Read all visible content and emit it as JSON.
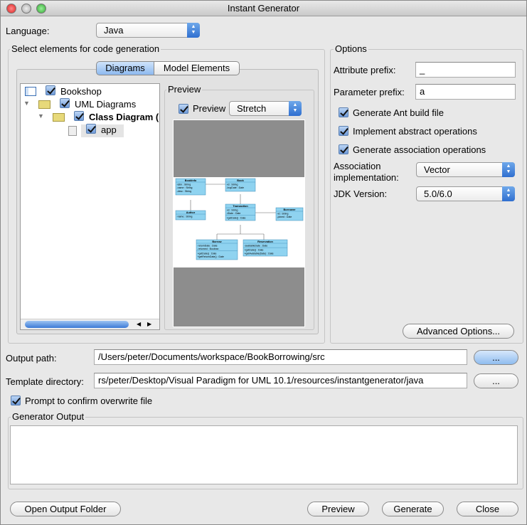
{
  "window": {
    "title": "Instant Generator"
  },
  "language": {
    "label": "Language:",
    "value": "Java"
  },
  "select_group": {
    "title": "Select elements for code generation",
    "tabs": [
      {
        "label": "Diagrams",
        "active": true
      },
      {
        "label": "Model Elements",
        "active": false
      }
    ]
  },
  "tree": [
    {
      "label": "Bookshop",
      "checked": true
    },
    {
      "label": "UML Diagrams",
      "checked": true
    },
    {
      "label": "Class Diagram (",
      "checked": true
    },
    {
      "label": "app",
      "checked": true
    }
  ],
  "preview": {
    "group_title": "Preview",
    "checkbox_label": "Preview",
    "checked": true,
    "mode": "Stretch",
    "diagram": {
      "classes": [
        {
          "name": "BookInfo",
          "attrs": [
            "-isbn : String",
            "-name : String",
            "-desc : String"
          ],
          "ops": []
        },
        {
          "name": "Book",
          "attrs": [
            "-id : String",
            "-buyDate : Date"
          ],
          "ops": []
        },
        {
          "name": "Author",
          "attrs": [
            "-name : String"
          ],
          "ops": []
        },
        {
          "name": "Transaction",
          "attrs": [
            "-id : String",
            "-tDate : Date"
          ],
          "ops": [
            "+getDate() : Date"
          ]
        },
        {
          "name": "Borrower",
          "attrs": [
            "-id : String",
            "-joined : Date"
          ],
          "ops": []
        },
        {
          "name": "Borrow",
          "attrs": [
            "-returnDate : Date",
            "-returned : Boolean"
          ],
          "ops": [
            "+getDate() : Date",
            "+getReturnDate() : Date"
          ]
        },
        {
          "name": "Reservation",
          "attrs": [
            "-availableDate : Date"
          ],
          "ops": [
            "+getDate() : Date",
            "+getAvailable(Date) : Date"
          ]
        }
      ]
    }
  },
  "options": {
    "title": "Options",
    "attribute_prefix_label": "Attribute prefix:",
    "attribute_prefix": "_",
    "parameter_prefix_label": "Parameter prefix:",
    "parameter_prefix": "a",
    "checks": [
      {
        "label": "Generate Ant build file",
        "checked": true
      },
      {
        "label": "Implement abstract operations",
        "checked": true
      },
      {
        "label": "Generate association operations",
        "checked": true
      }
    ],
    "association_label_1": "Association",
    "association_label_2": "implementation:",
    "association_value": "Vector",
    "jdk_label": "JDK Version:",
    "jdk_value": "5.0/6.0",
    "advanced_button": "Advanced Options..."
  },
  "output_path": {
    "label": "Output path:",
    "value": "/Users/peter/Documents/workspace/BookBorrowing/src",
    "browse": "..."
  },
  "template_dir": {
    "label": "Template directory:",
    "value": "rs/peter/Desktop/Visual Paradigm for UML 10.1/resources/instantgenerator/java",
    "browse": "..."
  },
  "prompt_overwrite": {
    "label": "Prompt to confirm overwrite file",
    "checked": true
  },
  "generator_output": {
    "title": "Generator Output",
    "text": ""
  },
  "buttons": {
    "open_folder": "Open Output Folder",
    "preview": "Preview",
    "generate": "Generate",
    "close": "Close"
  }
}
